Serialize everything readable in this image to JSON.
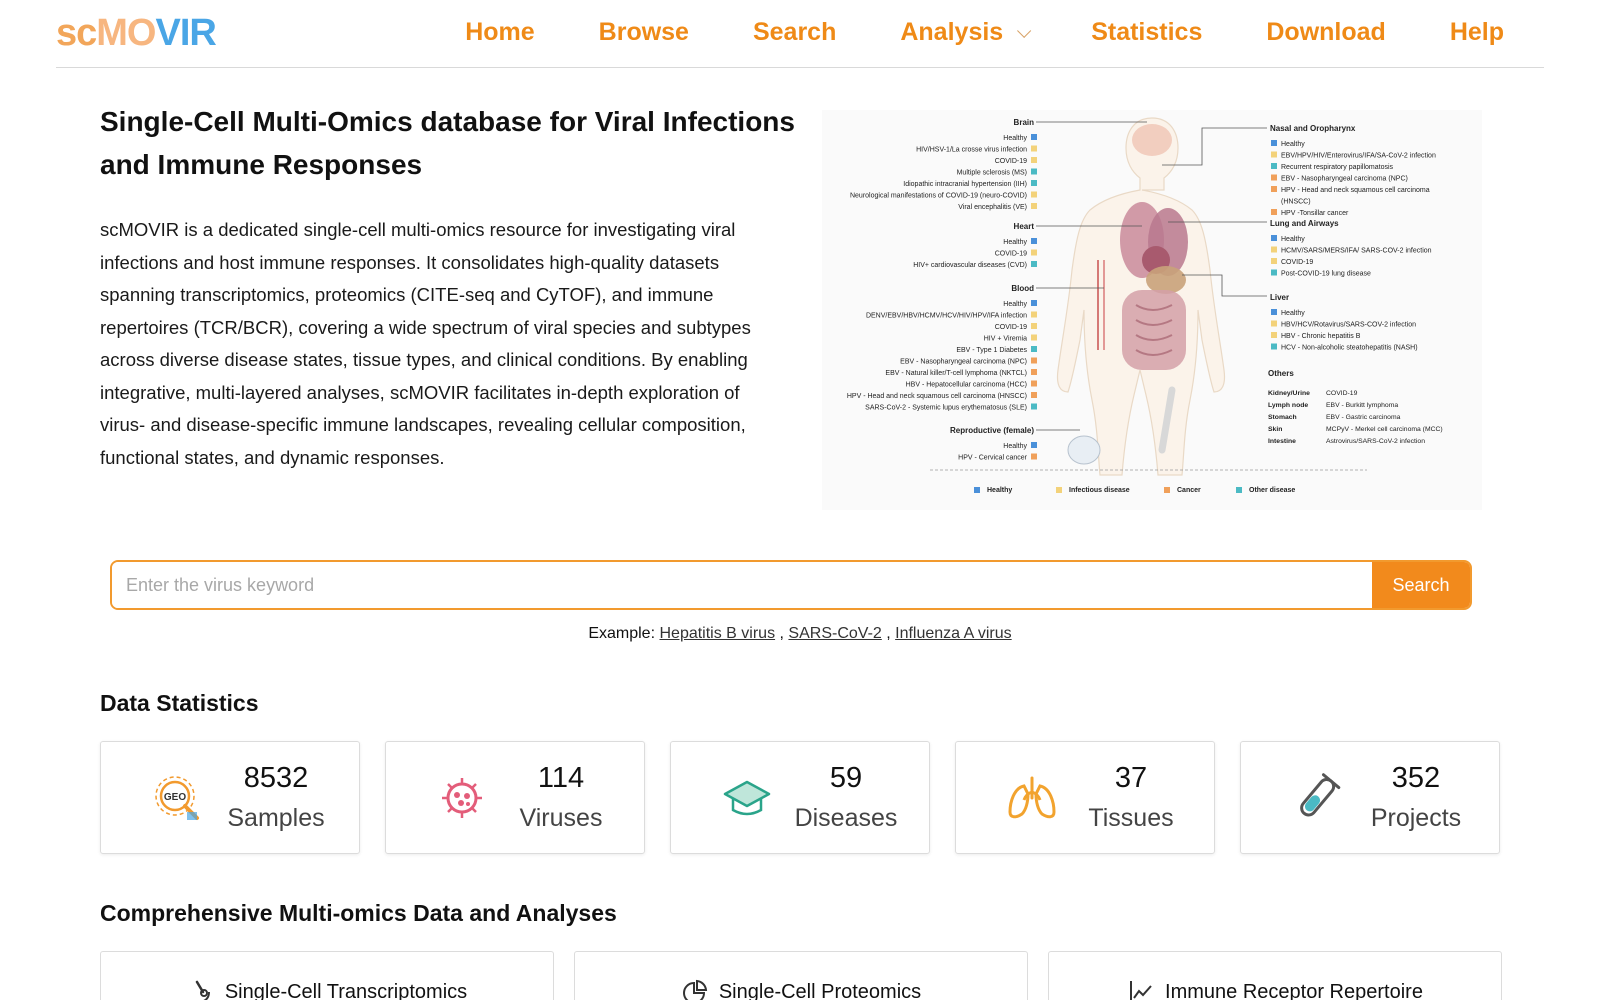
{
  "header": {
    "logo": {
      "part1": "sc",
      "part2": "MO",
      "part3": "VIR"
    },
    "nav": [
      {
        "label": "Home"
      },
      {
        "label": "Browse"
      },
      {
        "label": "Search"
      },
      {
        "label": "Analysis"
      },
      {
        "label": "Statistics"
      },
      {
        "label": "Download"
      },
      {
        "label": "Help"
      }
    ]
  },
  "hero": {
    "title": "Single-Cell Multi-Omics database for Viral Infections and Immune Responses",
    "description": "scMOVIR is a dedicated single-cell multi-omics resource for investigating viral infections and host immune responses. It consolidates high-quality datasets spanning transcriptomics, proteomics (CITE-seq and CyTOF), and immune repertoires (TCR/BCR), covering a wide spectrum of viral species and subtypes across diverse disease states, tissue types, and clinical conditions. By enabling integrative, multi-layered analyses, scMOVIR facilitates in-depth exploration of virus- and disease-specific immune landscapes, revealing cellular composition, functional states, and dynamic responses."
  },
  "figure": {
    "left_groups": [
      {
        "title": "Brain",
        "items": [
          {
            "text": "Healthy",
            "cat": "healthy"
          },
          {
            "text": "HIV/HSV-1/La crosse virus infection",
            "cat": "infectious"
          },
          {
            "text": "COVID-19",
            "cat": "infectious"
          },
          {
            "text": "Multiple sclerosis (MS)",
            "cat": "other"
          },
          {
            "text": "Idiopathic intracranial hypertension (IIH)",
            "cat": "other"
          },
          {
            "text": "Neurological manifestations of COVID-19 (neuro-COVID)",
            "cat": "infectious"
          },
          {
            "text": "Viral encephalitis (VE)",
            "cat": "infectious"
          }
        ]
      },
      {
        "title": "Heart",
        "items": [
          {
            "text": "Healthy",
            "cat": "healthy"
          },
          {
            "text": "COVID-19",
            "cat": "infectious"
          },
          {
            "text": "HIV+ cardiovascular diseases (CVD)",
            "cat": "other"
          }
        ]
      },
      {
        "title": "Blood",
        "items": [
          {
            "text": "Healthy",
            "cat": "healthy"
          },
          {
            "text": "DENV/EBV/HBV/HCMV/HCV/HIV/HPV/IFA infection",
            "cat": "infectious"
          },
          {
            "text": "COVID-19",
            "cat": "infectious"
          },
          {
            "text": "HIV + Viremia",
            "cat": "infectious"
          },
          {
            "text": "EBV - Type 1 Diabetes",
            "cat": "other"
          },
          {
            "text": "EBV - Nasopharyngeal carcinoma (NPC)",
            "cat": "cancer"
          },
          {
            "text": "EBV - Natural killer/T-cell lymphoma (NKTCL)",
            "cat": "cancer"
          },
          {
            "text": "HBV - Hepatocellular carcinoma (HCC)",
            "cat": "cancer"
          },
          {
            "text": "HPV - Head and neck squamous cell carcinoma (HNSCC)",
            "cat": "cancer"
          },
          {
            "text": "SARS-CoV-2 - Systemic lupus erythematosus (SLE)",
            "cat": "other"
          }
        ]
      },
      {
        "title": "Reproductive (female)",
        "items": [
          {
            "text": "Healthy",
            "cat": "healthy"
          },
          {
            "text": "HPV - Cervical cancer",
            "cat": "cancer"
          }
        ]
      }
    ],
    "right_groups": [
      {
        "title": "Nasal and Oropharynx",
        "items": [
          {
            "text": "Healthy",
            "cat": "healthy"
          },
          {
            "text": "EBV/HPV/HIV/Enterovirus/IFA/SA-CoV-2 infection",
            "cat": "infectious"
          },
          {
            "text": "Recurrent respiratory papillomatosis",
            "cat": "other"
          },
          {
            "text": "EBV - Nasopharyngeal carcinoma (NPC)",
            "cat": "cancer"
          },
          {
            "text": "HPV - Head and neck squamous cell carcinoma",
            "cat": "cancer"
          },
          {
            "text": "(HNSCC)",
            "cat": ""
          },
          {
            "text": "HPV -Tonsillar cancer",
            "cat": "cancer"
          }
        ]
      },
      {
        "title": "Lung and Airways",
        "items": [
          {
            "text": "Healthy",
            "cat": "healthy"
          },
          {
            "text": "HCMV/SARS/MERS/IFA/ SARS-COV-2 infection",
            "cat": "infectious"
          },
          {
            "text": "COVID-19",
            "cat": "infectious"
          },
          {
            "text": "Post-COVID-19 lung disease",
            "cat": "other"
          }
        ]
      },
      {
        "title": "Liver",
        "items": [
          {
            "text": "Healthy",
            "cat": "healthy"
          },
          {
            "text": "HBV/HCV/Rotavirus/SARS-COV-2 infection",
            "cat": "infectious"
          },
          {
            "text": "HBV - Chronic hepatitis B",
            "cat": "infectious"
          },
          {
            "text": "HCV - Non-alcoholic steatohepatitis (NASH)",
            "cat": "other"
          }
        ]
      }
    ],
    "others": {
      "title": "Others",
      "rows": [
        {
          "organ": "Kidney/Urine",
          "text": "COVID-19"
        },
        {
          "organ": "Lymph node",
          "text": "EBV - Burkitt lymphoma"
        },
        {
          "organ": "Stomach",
          "text": "EBV - Gastric carcinoma"
        },
        {
          "organ": "Skin",
          "text": "MCPyV - Merkel cell carcinoma (MCC)"
        },
        {
          "organ": "Intestine",
          "text": "Astrovirus/SARS-CoV-2 infection"
        }
      ]
    },
    "legend": [
      {
        "label": "Healthy",
        "cat": "healthy"
      },
      {
        "label": "Infectious disease",
        "cat": "infectious"
      },
      {
        "label": "Cancer",
        "cat": "cancer"
      },
      {
        "label": "Other disease",
        "cat": "other"
      }
    ],
    "colors": {
      "healthy": "#4a90d9",
      "infectious": "#f3d27a",
      "cancer": "#f0a05a",
      "other": "#4bbac4"
    }
  },
  "search": {
    "placeholder": "Enter the virus keyword",
    "button": "Search",
    "example_label": "Example:",
    "examples": [
      "Hepatitis B virus",
      "SARS-CoV-2",
      "Influenza A virus"
    ]
  },
  "stats": {
    "title": "Data Statistics",
    "cards": [
      {
        "value": "8532",
        "label": "Samples",
        "icon": "geo-icon",
        "color": "#f29a2e"
      },
      {
        "value": "114",
        "label": "Viruses",
        "icon": "virus-icon",
        "color": "#e35d7a"
      },
      {
        "value": "59",
        "label": "Diseases",
        "icon": "graduation-cap-icon",
        "color": "#2aa48a"
      },
      {
        "value": "37",
        "label": "Tissues",
        "icon": "lungs-icon",
        "color": "#f2a32e"
      },
      {
        "value": "352",
        "label": "Projects",
        "icon": "test-tube-icon",
        "color": "#555555"
      }
    ]
  },
  "omics": {
    "title": "Comprehensive Multi-omics Data and Analyses",
    "cards": [
      {
        "label": "Single-Cell Transcriptomics",
        "icon": "microscope-icon"
      },
      {
        "label": "Single-Cell Proteomics",
        "icon": "pie-chart-icon"
      },
      {
        "label": "Immune Receptor Repertoire",
        "icon": "line-chart-icon"
      }
    ]
  }
}
